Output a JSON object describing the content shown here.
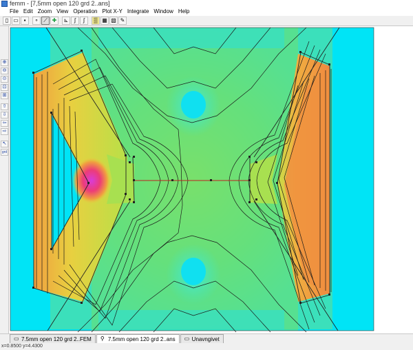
{
  "window": {
    "title": "femm - [7,5mm open 120 grd 2..ans]"
  },
  "menu": [
    "File",
    "Edit",
    "Zoom",
    "View",
    "Operation",
    "Plot X-Y",
    "Integrate",
    "Window",
    "Help"
  ],
  "toolbar": {
    "buttons": [
      {
        "name": "new-file-icon",
        "glyph": "▯"
      },
      {
        "name": "open-file-icon",
        "glyph": "▭"
      },
      {
        "name": "save-icon",
        "glyph": "▪"
      },
      {
        "name": "point-mode-icon",
        "glyph": "∘"
      },
      {
        "name": "contour-mode-icon",
        "glyph": "⟋"
      },
      {
        "name": "area-mode-icon",
        "glyph": "✚"
      },
      {
        "name": "plot-xy-icon",
        "glyph": "⊾"
      },
      {
        "name": "line-integral-icon",
        "glyph": "∫"
      },
      {
        "name": "block-integral-icon",
        "glyph": "∫"
      },
      {
        "name": "show-density-icon",
        "glyph": "▒"
      },
      {
        "name": "show-grid-icon",
        "glyph": "▦"
      },
      {
        "name": "mesh-icon",
        "glyph": "▧"
      },
      {
        "name": "tools-icon",
        "glyph": "✎"
      }
    ]
  },
  "left_toolbar": [
    {
      "name": "zoom-in-icon",
      "glyph": "⊕"
    },
    {
      "name": "zoom-out-icon",
      "glyph": "⊖"
    },
    {
      "name": "zoom-natural-icon",
      "glyph": "⊙"
    },
    {
      "name": "zoom-window-icon",
      "glyph": "⊡"
    },
    {
      "name": "zoom-all-icon",
      "glyph": "⊞"
    },
    {
      "name": "pan-up-icon",
      "glyph": "⇧"
    },
    {
      "name": "pan-down-icon",
      "glyph": "⇩"
    },
    {
      "name": "pan-left-icon",
      "glyph": "⇦"
    },
    {
      "name": "pan-right-icon",
      "glyph": "⇨"
    },
    {
      "name": "pointer-icon",
      "glyph": "↖"
    },
    {
      "name": "grid-size-icon",
      "glyph": "grd"
    }
  ],
  "tabs": [
    {
      "label": "7.5mm open 120 grd 2..FEM",
      "icon": "document-icon",
      "glyph": "▭",
      "active": false
    },
    {
      "label": "7.5mm open 120 grd 2..ans",
      "icon": "solution-icon",
      "glyph": "⚲",
      "active": true
    },
    {
      "label": "Unavngivet",
      "icon": "document-icon",
      "glyph": "▭",
      "active": false
    }
  ],
  "status": {
    "text": "x=0.8500 y=4.4300"
  },
  "colors": {
    "background_cyan": "#00e4f6",
    "field_low": "#3ee0b8",
    "field_mid": "#7ee05a",
    "field_high": "#d8e040",
    "field_peak_orange": "#f0a040",
    "field_peak_red": "#ec3c78",
    "field_peak_magenta": "#d83cd8"
  }
}
